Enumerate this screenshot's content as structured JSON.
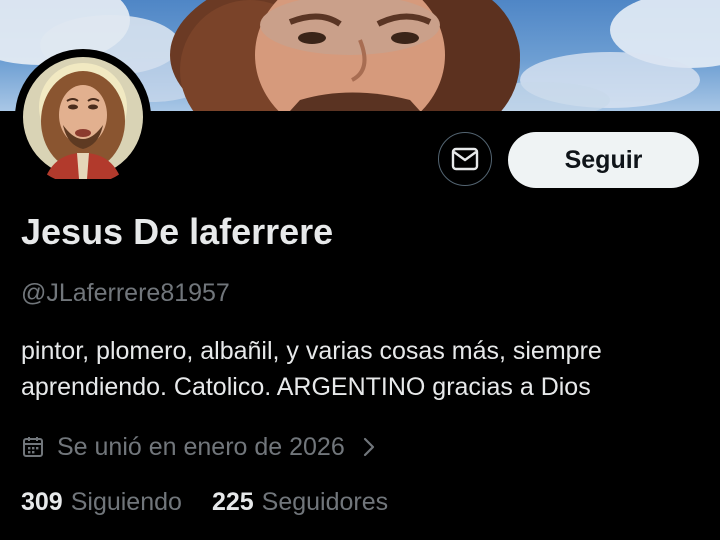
{
  "profile": {
    "display_name": "Jesus De laferrere",
    "handle": "@JLaferrere81957",
    "bio_lines": [
      "pintor, plomero, albañil, y varias cosas más, siempre",
      "aprendiendo. Catolico. ARGENTINO gracias a Dios"
    ],
    "joined": "Se unió en enero de 2026"
  },
  "actions": {
    "message_icon": "envelope-icon",
    "follow_label": "Seguir"
  },
  "stats": {
    "following_count": "309",
    "following_label": "Siguiendo",
    "followers_count": "225",
    "followers_label": "Seguidores"
  },
  "colors": {
    "background": "#000000",
    "primary_text": "#e7e9ea",
    "secondary_text": "#71767b",
    "follow_button_bg": "#eff3f4",
    "follow_button_text": "#0f1419",
    "outline": "#536471"
  }
}
